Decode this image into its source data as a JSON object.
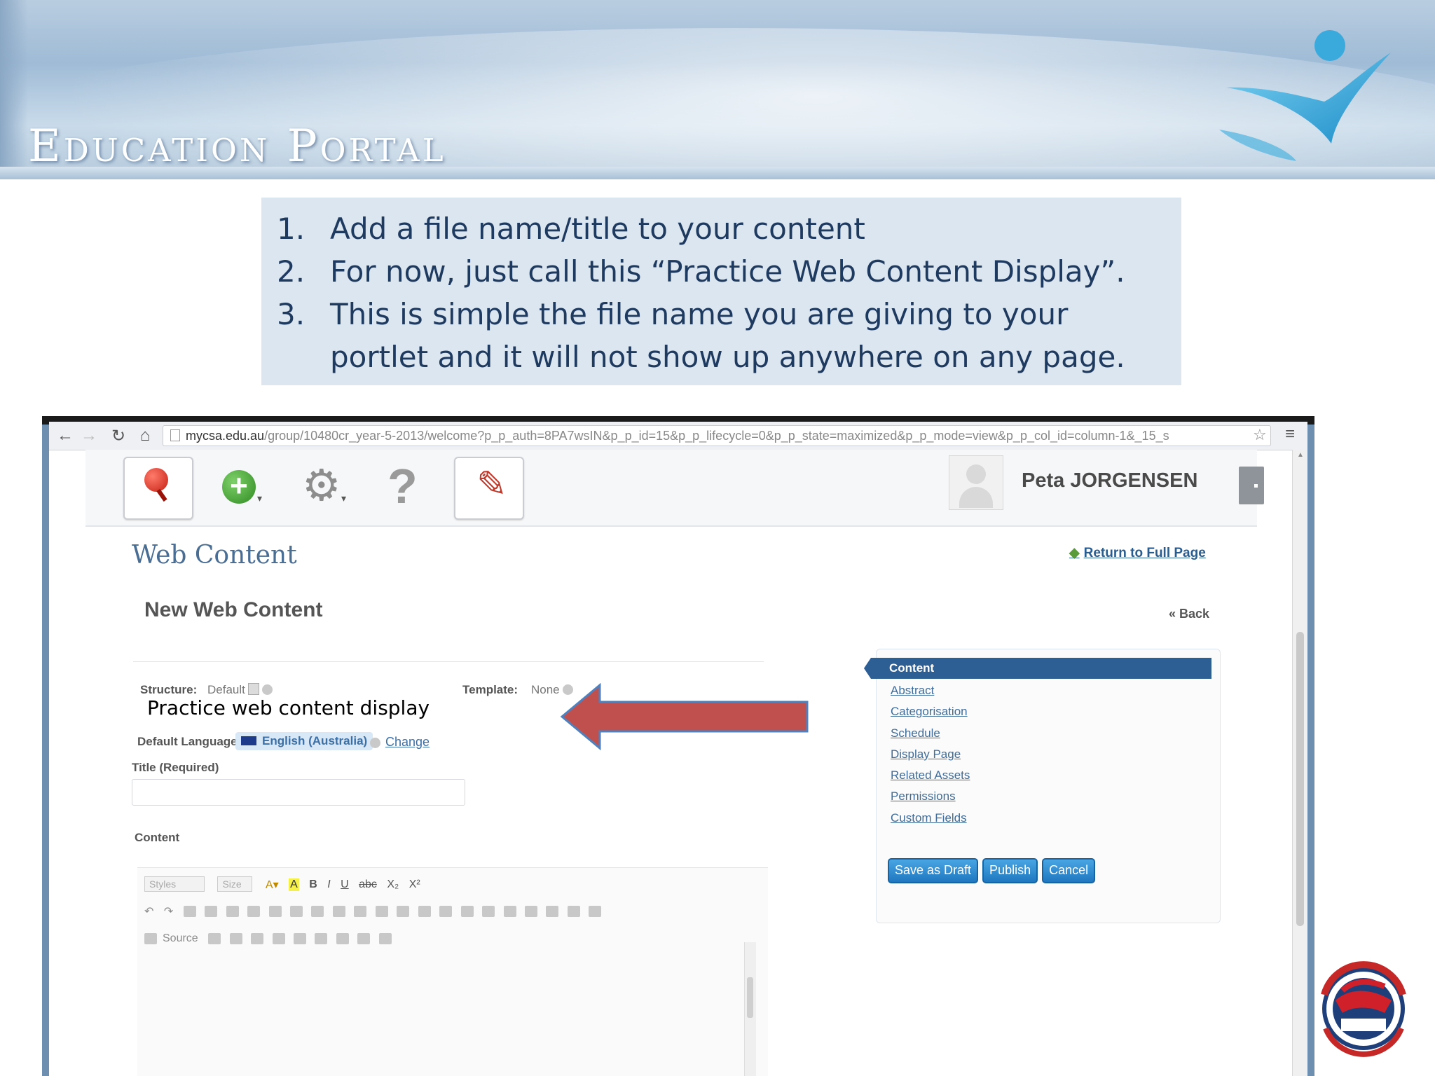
{
  "banner": {
    "title": "Education Portal"
  },
  "instructions": [
    {
      "num": "1.",
      "text": "Add a file name/title to your content"
    },
    {
      "num": "2.",
      "text": "For now, just call this “Practice Web Content Display”."
    },
    {
      "num": "3.",
      "text": "This is simple the file name you are giving to your portlet and it will not show up anywhere on any page."
    }
  ],
  "browser": {
    "url_host": "mycsa.edu.au",
    "url_path": "/group/10480cr_year-5-2013/welcome?p_p_auth=8PA7wsIN&p_p_id=15&p_p_lifecycle=0&p_p_state=maximized&p_p_mode=view&p_p_col_id=column-1&_15_s"
  },
  "dockbar": {
    "user_name": "Peta JORGENSEN"
  },
  "portlet": {
    "title": "Web Content",
    "return_link": "Return to Full Page",
    "heading": "New Web Content",
    "back": "« Back",
    "structure_label": "Structure:",
    "structure_value": "Default",
    "template_label": "Template:",
    "template_value": "None",
    "default_language_label": "Default Language:",
    "language": "English (Australia)",
    "change": "Change",
    "title_label": "Title (Required)",
    "title_value": "",
    "content_label": "Content"
  },
  "overlay": {
    "text": "Practice web content display"
  },
  "editor": {
    "styles_placeholder": "Styles",
    "size_placeholder": "Size",
    "source_label": "Source"
  },
  "side_panel": {
    "header": "Content",
    "links": [
      "Abstract",
      "Categorisation",
      "Schedule",
      "Display Page",
      "Related Assets",
      "Permissions",
      "Custom Fields"
    ],
    "buttons": {
      "save_draft": "Save as Draft",
      "publish": "Publish",
      "cancel": "Cancel"
    }
  },
  "colors": {
    "arrow": "#c0504d",
    "primary_button": "#1f78c0",
    "header": "#2d5f94"
  }
}
